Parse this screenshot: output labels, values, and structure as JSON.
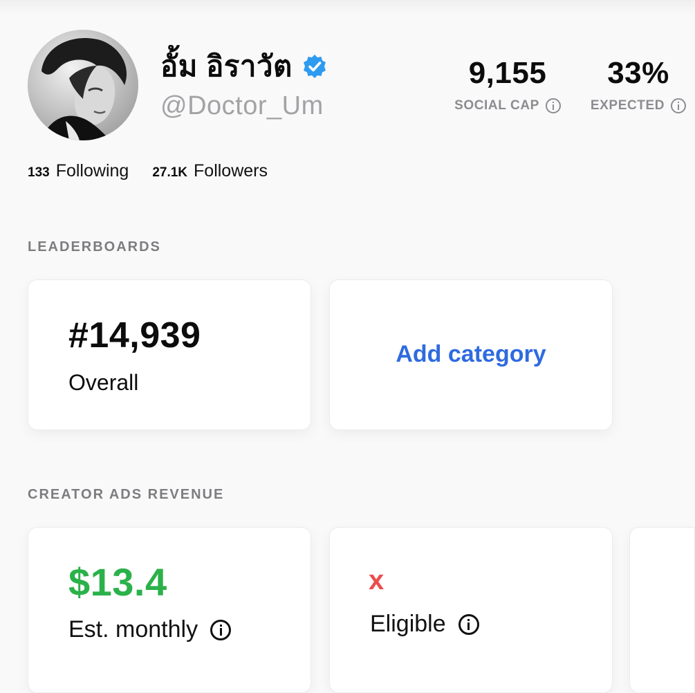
{
  "profile": {
    "display_name": "อั้ม อิราวัต",
    "handle": "@Doctor_Um",
    "verified": true,
    "avatar_icon": "profile-photo",
    "following_count": "133",
    "following_label": "Following",
    "followers_count": "27.1K",
    "followers_label": "Followers"
  },
  "stats": [
    {
      "value": "9,155",
      "label": "SOCIAL CAP"
    },
    {
      "value": "33%",
      "label": "EXPECTED"
    }
  ],
  "leaderboards": {
    "title": "LEADERBOARDS",
    "rank": "#14,939",
    "rank_label": "Overall",
    "add_category_label": "Add category"
  },
  "ads_revenue": {
    "title": "CREATOR ADS REVENUE",
    "monthly_value": "$13.4",
    "monthly_label": "Est. monthly",
    "eligible_mark": "x",
    "eligible_label": "Eligible"
  },
  "colors": {
    "verified_blue": "#2f9bf0",
    "link_blue": "#2f6be0",
    "money_green": "#2bb14a",
    "ineligible_red": "#ee4d4d",
    "muted_gray": "#8c8c90"
  }
}
